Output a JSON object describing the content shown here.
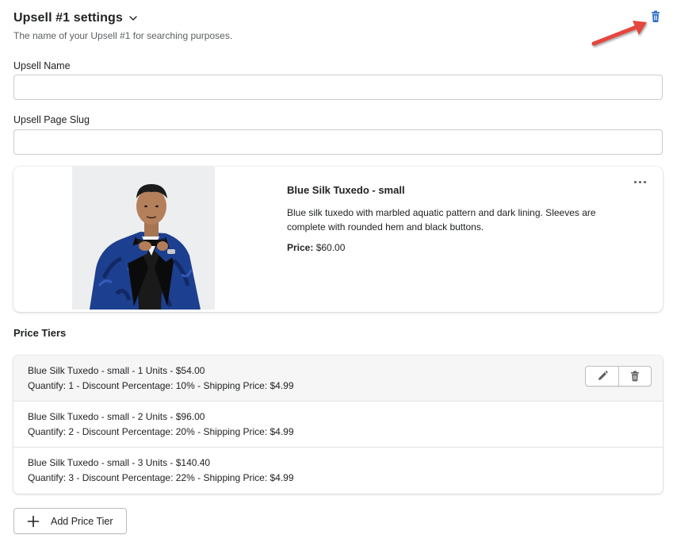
{
  "header": {
    "title": "Upsell #1 settings",
    "subtitle": "The name of your Upsell #1 for searching purposes."
  },
  "fields": {
    "upsell_name_label": "Upsell Name",
    "upsell_name_value": "",
    "page_slug_label": "Upsell Page Slug",
    "page_slug_value": ""
  },
  "product": {
    "name": "Blue Silk Tuxedo - small",
    "description": "Blue silk tuxedo with marbled aquatic pattern and dark lining. Sleeves are complete with rounded hem and black buttons.",
    "price_label": "Price:",
    "price_value": "$60.00"
  },
  "price_tiers": {
    "section_title": "Price Tiers",
    "items": [
      {
        "title": "Blue Silk Tuxedo - small - 1 Units - $54.00",
        "details": "Quantify: 1 - Discount Percentage: 10% - Shipping Price: $4.99"
      },
      {
        "title": "Blue Silk Tuxedo - small - 2 Units - $96.00",
        "details": "Quantify: 2 - Discount Percentage: 20% - Shipping Price: $4.99"
      },
      {
        "title": "Blue Silk Tuxedo - small - 3 Units - $140.40",
        "details": "Quantify: 3 - Discount Percentage: 22% - Shipping Price: $4.99"
      }
    ],
    "add_button_label": "Add Price Tier"
  },
  "icons": {
    "top_delete": "trash-icon",
    "dropdown": "chevron-down-icon",
    "more": "more-horizontal-icon",
    "edit": "pencil-icon",
    "delete": "trash-icon",
    "add": "plus-icon",
    "annotation": "red-arrow-icon"
  },
  "colors": {
    "accent_blue": "#2c6ecb",
    "annotation_red": "#e4473c",
    "text": "#202223",
    "muted_text": "#5c5f62",
    "border": "#c9cccf"
  }
}
